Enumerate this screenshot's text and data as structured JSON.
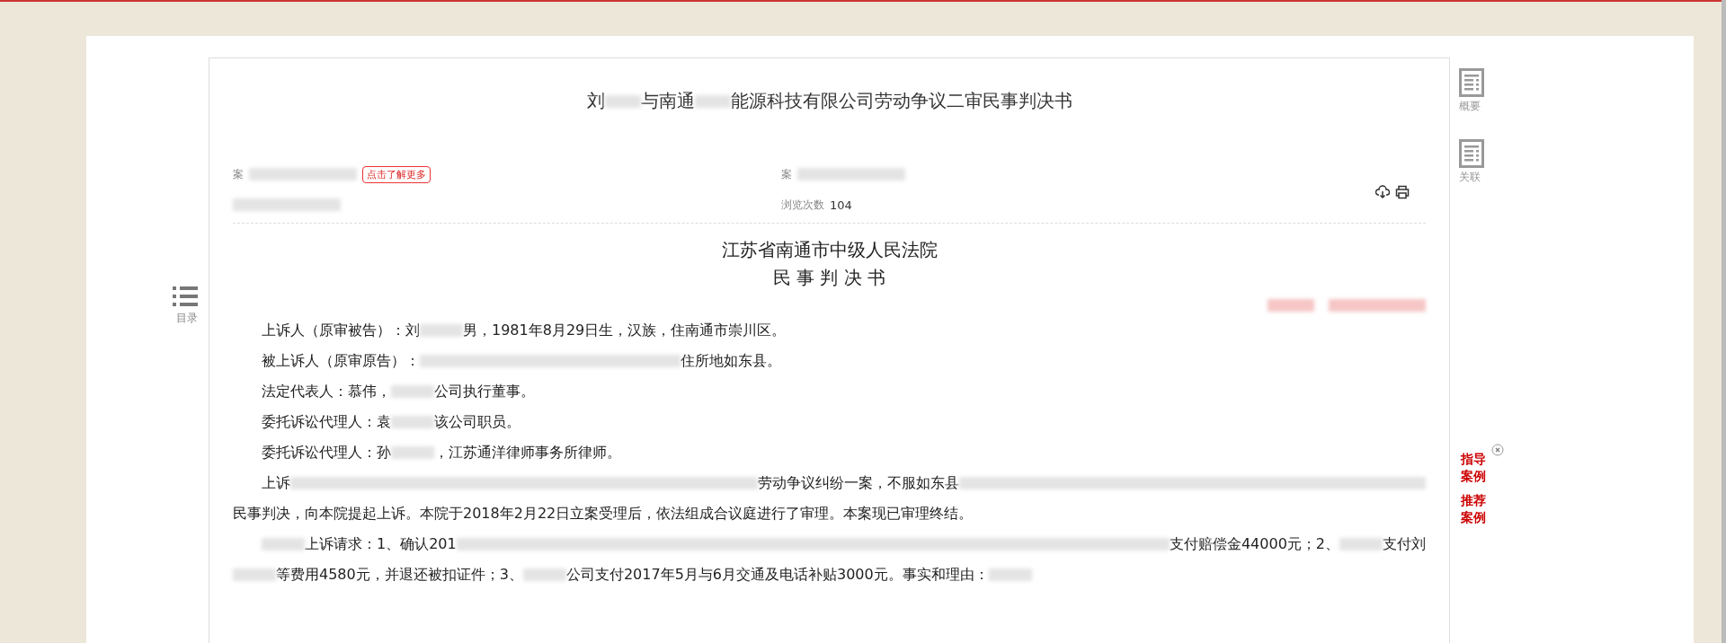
{
  "title": [
    {
      "kind": "text",
      "text": "刘"
    },
    {
      "kind": "redacted"
    },
    {
      "kind": "text",
      "text": "与南通"
    },
    {
      "kind": "redacted"
    },
    {
      "kind": "text",
      "text": "能源科技有限公司劳动争议二审民事判决书"
    }
  ],
  "meta": [
    {
      "label": "案",
      "redacted": true,
      "button": "点击了解更多"
    },
    {
      "label": "案",
      "redacted": true
    },
    {
      "redacted": true
    },
    {
      "label": "浏览次数",
      "value": "104",
      "redacted": false
    }
  ],
  "toc": {
    "label": "目录"
  },
  "court": "江苏省南通市中级人民法院",
  "doc_type": "民 事 判 决 书",
  "paragraphs": [
    {
      "lines": [
        [
          {
            "kind": "text",
            "text": "上诉人（原审被告）：刘"
          },
          {
            "kind": "redacted"
          },
          {
            "kind": "text",
            "text": "男，1981年8月29日生，汉族，住南通市崇川区。"
          }
        ]
      ]
    },
    {
      "lines": [
        [
          {
            "kind": "text",
            "text": "被上诉人（原审原告）："
          },
          {
            "kind": "redacted-wide"
          },
          {
            "kind": "text",
            "text": "住所地如东县。"
          }
        ]
      ]
    },
    {
      "lines": [
        [
          {
            "kind": "text",
            "text": "法定代表人：慕伟，"
          },
          {
            "kind": "redacted"
          },
          {
            "kind": "text",
            "text": "公司执行董事。"
          }
        ]
      ]
    },
    {
      "lines": [
        [
          {
            "kind": "text",
            "text": "委托诉讼代理人：袁"
          },
          {
            "kind": "redacted"
          },
          {
            "kind": "text",
            "text": "该公司职员。"
          }
        ]
      ]
    },
    {
      "lines": [
        [
          {
            "kind": "text",
            "text": "委托诉讼代理人：孙"
          },
          {
            "kind": "redacted"
          },
          {
            "kind": "text",
            "text": "，江苏通洋律师事务所律师。"
          }
        ]
      ]
    },
    {
      "lines": [
        [
          {
            "kind": "text",
            "text": "上诉"
          },
          {
            "kind": "redacted-long"
          },
          {
            "kind": "text",
            "text": "劳动争议纠纷一案，不服如东县"
          },
          {
            "kind": "redacted-long"
          }
        ],
        [
          {
            "kind": "text",
            "text": "民事判决，向本院提起上诉。本院于2018年2月22日立案受理后，依法组成合议庭进行了审理。本案现已审理终结。"
          }
        ]
      ]
    },
    {
      "lines": [
        [
          {
            "kind": "redacted"
          },
          {
            "kind": "text",
            "text": "上诉请求：1、确认201"
          },
          {
            "kind": "redacted-long"
          },
          {
            "kind": "text",
            "text": "支付赔偿金44000元；2、"
          },
          {
            "kind": "redacted"
          },
          {
            "kind": "text",
            "text": "支付刘"
          }
        ],
        [
          {
            "kind": "redacted"
          },
          {
            "kind": "text",
            "text": "等费用4580元，并退还被扣证件；3、"
          },
          {
            "kind": "redacted"
          },
          {
            "kind": "text",
            "text": "公司支付2017年5月与6月交通及电话补贴3000元。事实和理由："
          },
          {
            "kind": "redacted"
          }
        ]
      ]
    }
  ],
  "side_tools": [
    {
      "label": "概要"
    },
    {
      "label": "关联"
    }
  ],
  "recommend": [
    "指导案例",
    "推荐案例"
  ]
}
